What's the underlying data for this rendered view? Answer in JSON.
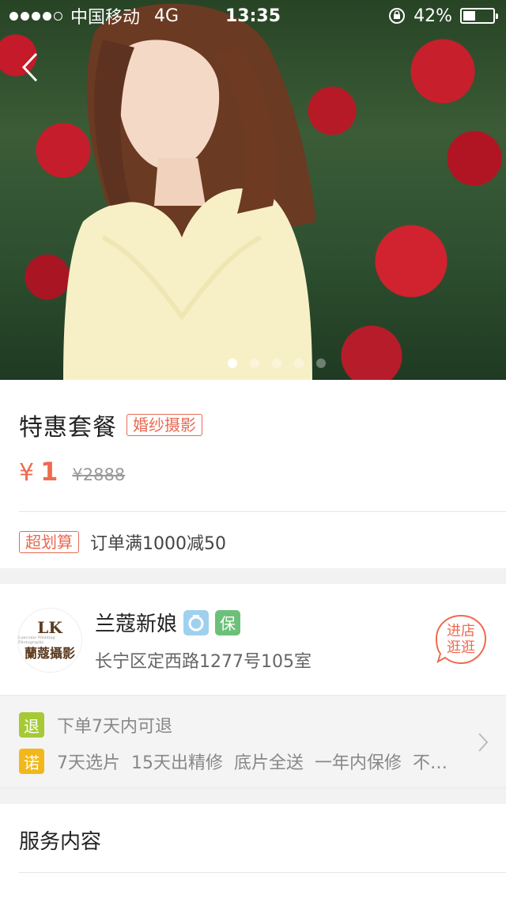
{
  "status_bar": {
    "carrier": "中国移动",
    "network": "4G",
    "time": "13:35",
    "battery": "42%",
    "battery_level": 0.42,
    "signal_bars_filled": 4,
    "signal_bars_total": 5
  },
  "hero": {
    "image_description": "bride in lace dress before red roses",
    "page_count": 5,
    "active_page": 1
  },
  "product": {
    "title": "特惠套餐",
    "category_tag": "婚纱摄影",
    "currency": "¥",
    "price": "1",
    "original_price": "¥2888",
    "promo_tag": "超划算",
    "promo_text": "订单满1000减50"
  },
  "shop": {
    "name": "兰蔻新娘",
    "logo_monogram": "LK",
    "logo_subtitle": "Lancome Wedding Photography",
    "logo_cn": "蘭蔻攝影",
    "bao_badge": "保",
    "address": "长宁区定西路1277号105室",
    "visit_line1": "进店",
    "visit_line2": "逛逛"
  },
  "guarantee": {
    "refund_icon": "退",
    "refund_text": "下单7天内可退",
    "promise_icon": "诺",
    "promise_text": "7天选片  15天出精修  底片全送  一年内保修  不…"
  },
  "service": {
    "title": "服务内容"
  },
  "colors": {
    "accent": "#f06a4f",
    "refund_green": "#a6c935",
    "promise_yellow": "#f2b81b",
    "bao_green": "#6cc07a",
    "diamond_blue": "#9fd1ef"
  }
}
